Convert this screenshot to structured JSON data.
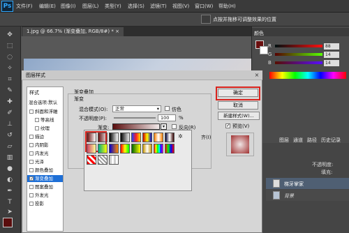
{
  "menubar": {
    "logo": "Ps",
    "items": [
      "文件(F)",
      "编辑(E)",
      "图像(I)",
      "图层(L)",
      "类型(Y)",
      "选择(S)",
      "滤镜(T)",
      "视图(V)",
      "窗口(W)",
      "帮助(H)"
    ]
  },
  "options_bar": {
    "hint": "点按并拖移可调整效果的位置"
  },
  "document": {
    "tab": "1.jpg @ 66.7% (渐变叠加, RGB/8#) *",
    "close": "×"
  },
  "color_panel": {
    "tab": "颜色",
    "sliders": [
      {
        "label": "R",
        "value": "88",
        "gradient": "linear-gradient(90deg,#001010,#ff1010)"
      },
      {
        "label": "G",
        "value": "14",
        "gradient": "linear-gradient(90deg,#580000,#58ff00)"
      },
      {
        "label": "B",
        "value": "14",
        "gradient": "linear-gradient(90deg,#580e00,#580eff)"
      }
    ]
  },
  "lower_panel": {
    "tabs": [
      "图层",
      "通道",
      "路径",
      "历史记录"
    ],
    "opacity_label": "不透明度:",
    "fill_label": "填充:",
    "layers": [
      {
        "name": "梯牙掌家"
      },
      {
        "name": "背景"
      }
    ]
  },
  "dialog": {
    "title": "图层样式",
    "close": "×",
    "styles_header": "样式",
    "blend_options": "混合选项:默认",
    "styles": [
      {
        "label": "斜面和浮雕",
        "checked": false,
        "indent": false,
        "selected": false
      },
      {
        "label": "等高线",
        "checked": false,
        "indent": true,
        "selected": false
      },
      {
        "label": "纹理",
        "checked": false,
        "indent": true,
        "selected": false
      },
      {
        "label": "描边",
        "checked": false,
        "indent": false,
        "selected": false
      },
      {
        "label": "内阴影",
        "checked": false,
        "indent": false,
        "selected": false
      },
      {
        "label": "内发光",
        "checked": false,
        "indent": false,
        "selected": false
      },
      {
        "label": "光泽",
        "checked": false,
        "indent": false,
        "selected": false
      },
      {
        "label": "颜色叠加",
        "checked": false,
        "indent": false,
        "selected": false
      },
      {
        "label": "渐变叠加",
        "checked": true,
        "indent": false,
        "selected": true
      },
      {
        "label": "图案叠加",
        "checked": false,
        "indent": false,
        "selected": false
      },
      {
        "label": "外发光",
        "checked": false,
        "indent": false,
        "selected": false
      },
      {
        "label": "投影",
        "checked": false,
        "indent": false,
        "selected": false
      }
    ],
    "section_title": "渐变叠加",
    "group_title": "渐变",
    "blend_mode_label": "混合模式(O):",
    "blend_mode_value": "正常",
    "dither_label": "仿色",
    "opacity_label": "不透明度(P):",
    "opacity_value": "100",
    "opacity_unit": "%",
    "gradient_label": "渐变:",
    "reverse_label": "反向(R)",
    "align_label": "齐(I)",
    "buttons": {
      "ok": "确定",
      "cancel": "取消",
      "new_style": "新建样式(W)...",
      "preview": "预览(V)"
    },
    "preview_checked": true
  },
  "gradient_picker": {
    "swatches": [
      "linear-gradient(90deg,#6a0e0e,#fff)",
      "linear-gradient(90deg,#6a0e0e,rgba(255,255,255,0))",
      "linear-gradient(90deg,#000,#fff)",
      "linear-gradient(90deg,#000,rgba(0,0,0,0))",
      "linear-gradient(90deg,#2040ff,#ff2020,#ffe000)",
      "linear-gradient(90deg,#c00,#ff0,#00c)",
      "linear-gradient(90deg,#ff8000,#fff,#ff8000)",
      "linear-gradient(90deg,#003,#fff,#300)",
      "linear-gradient(90deg,#c46,#ff9)",
      "linear-gradient(90deg,#0a8,#ff0)",
      "linear-gradient(90deg,#00c,#f80)",
      "linear-gradient(90deg,#f00,#ff0,#0f0)",
      "linear-gradient(90deg,#060,#ff0)",
      "linear-gradient(90deg,#c90,#fff,#c90)",
      "linear-gradient(90deg,#f00,#ff0,#0f0,#0ff,#00f,#f0f)",
      "linear-gradient(90deg,#f00,#0f0,#00f,#f00)",
      "repeating-linear-gradient(45deg,#f00 0 3px,#fff 3px 6px)",
      "repeating-linear-gradient(45deg,#999 0 2px,#fff 2px 4px)",
      "repeating-linear-gradient(90deg,#ccc 0 3px,#fff 3px 6px)"
    ]
  }
}
